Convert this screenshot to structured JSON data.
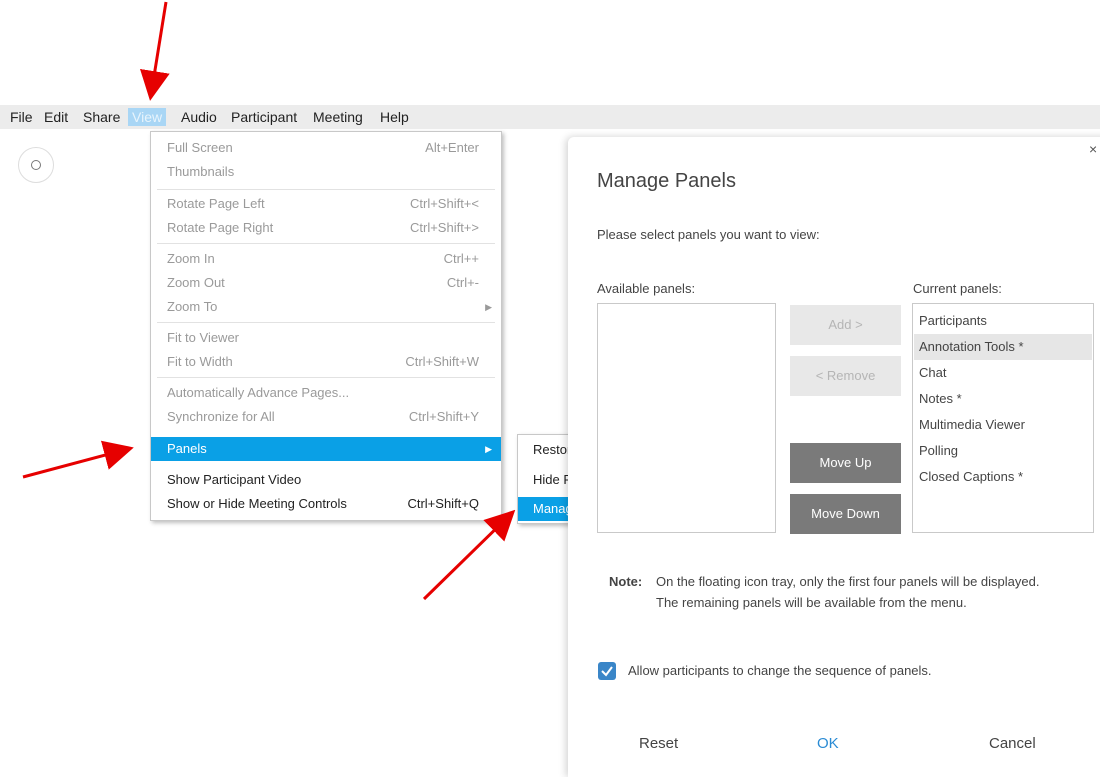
{
  "menubar": {
    "items": [
      {
        "label": "File",
        "u": "F"
      },
      {
        "label": "Edit",
        "u": "E"
      },
      {
        "label": "Share",
        "u": "S"
      },
      {
        "label": "View",
        "u": ""
      },
      {
        "label": "Audio",
        "u": "A"
      },
      {
        "label": "Participant",
        "u": "P"
      },
      {
        "label": "Meeting",
        "u": "M"
      },
      {
        "label": "Help",
        "u": "H"
      }
    ]
  },
  "view_menu": {
    "items": [
      {
        "label": "Full Screen",
        "shortcut": "Alt+Enter"
      },
      {
        "label": "Thumbnails",
        "shortcut": ""
      },
      {
        "label": "Rotate Page Left",
        "shortcut": "Ctrl+Shift+<"
      },
      {
        "label": "Rotate Page Right",
        "shortcut": "Ctrl+Shift+>"
      },
      {
        "label": "Zoom In",
        "shortcut": "Ctrl++"
      },
      {
        "label": "Zoom Out",
        "shortcut": "Ctrl+-"
      },
      {
        "label": "Zoom To",
        "shortcut": ""
      },
      {
        "label": "Fit to Viewer",
        "shortcut": ""
      },
      {
        "label": "Fit to Width",
        "shortcut": "Ctrl+Shift+W"
      },
      {
        "label": "Automatically Advance Pages...",
        "shortcut": ""
      },
      {
        "label": "Synchronize for All",
        "shortcut": "Ctrl+Shift+Y"
      },
      {
        "label": "Panels",
        "shortcut": ""
      },
      {
        "label": "Show Participant Video",
        "shortcut": ""
      },
      {
        "label": "Show or Hide Meeting Controls",
        "shortcut": "Ctrl+Shift+Q"
      }
    ]
  },
  "panels_submenu": {
    "items": [
      {
        "label": "Restore Layout"
      },
      {
        "label": "Hide Panels"
      },
      {
        "label": "Manage Panels..."
      }
    ]
  },
  "dialog": {
    "title": "Manage Panels",
    "subtitle": "Please select panels you want to view:",
    "available_label": "Available panels:",
    "current_label": "Current panels:",
    "current_panels": [
      "Participants",
      "Annotation Tools *",
      "Chat",
      "Notes *",
      "Multimedia Viewer",
      "Polling",
      "Closed Captions *"
    ],
    "buttons": {
      "add": "Add >",
      "remove": "< Remove",
      "move_up": "Move Up",
      "move_down": "Move Down"
    },
    "note_label": "Note:",
    "note_text": "On the floating icon tray, only the first four panels will be displayed. The remaining panels will be available from the menu.",
    "checkbox_label": "Allow participants to change the sequence of panels.",
    "footer": {
      "reset": "Reset",
      "ok": "OK",
      "cancel": "Cancel"
    },
    "close": "×"
  },
  "colors": {
    "highlight": "#0aa0e6",
    "ok": "#2a8bd4",
    "arrow": "#e60000",
    "checkbox": "#3a86c8"
  }
}
